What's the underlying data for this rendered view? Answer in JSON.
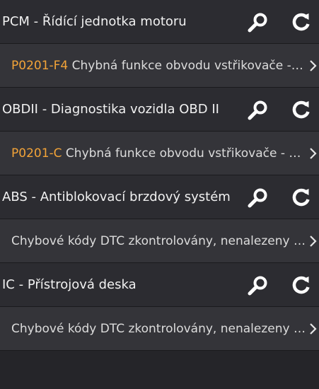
{
  "colors": {
    "dtc_code": "#f2a338",
    "text": "#f1f1f1",
    "module_bg": "#2c2c31",
    "code_bg": "#343439"
  },
  "modules": [
    {
      "title": "PCM - Řídící jednotka motoru",
      "icons": [
        "search-icon",
        "refresh-icon"
      ],
      "entry": {
        "code": "P0201-F4",
        "text": " Chybná funkce obvodu vstřikovače - …"
      }
    },
    {
      "title": "OBDII - Diagnostika vozidla OBD II",
      "icons": [
        "search-icon",
        "refresh-icon"
      ],
      "entry": {
        "code": "P0201-C",
        "text": " Chybná funkce obvodu vstřikovače - v…"
      }
    },
    {
      "title": "ABS - Antiblokovací brzdový systém",
      "icons": [
        "search-icon",
        "refresh-icon"
      ],
      "entry": {
        "code": "",
        "text": "Chybové kódy DTC zkontrolovány, nenalezeny …"
      }
    },
    {
      "title": "IC - Přístrojová deska",
      "icons": [
        "search-icon",
        "refresh-icon"
      ],
      "entry": {
        "code": "",
        "text": "Chybové kódy DTC zkontrolovány, nenalezeny …"
      }
    }
  ]
}
